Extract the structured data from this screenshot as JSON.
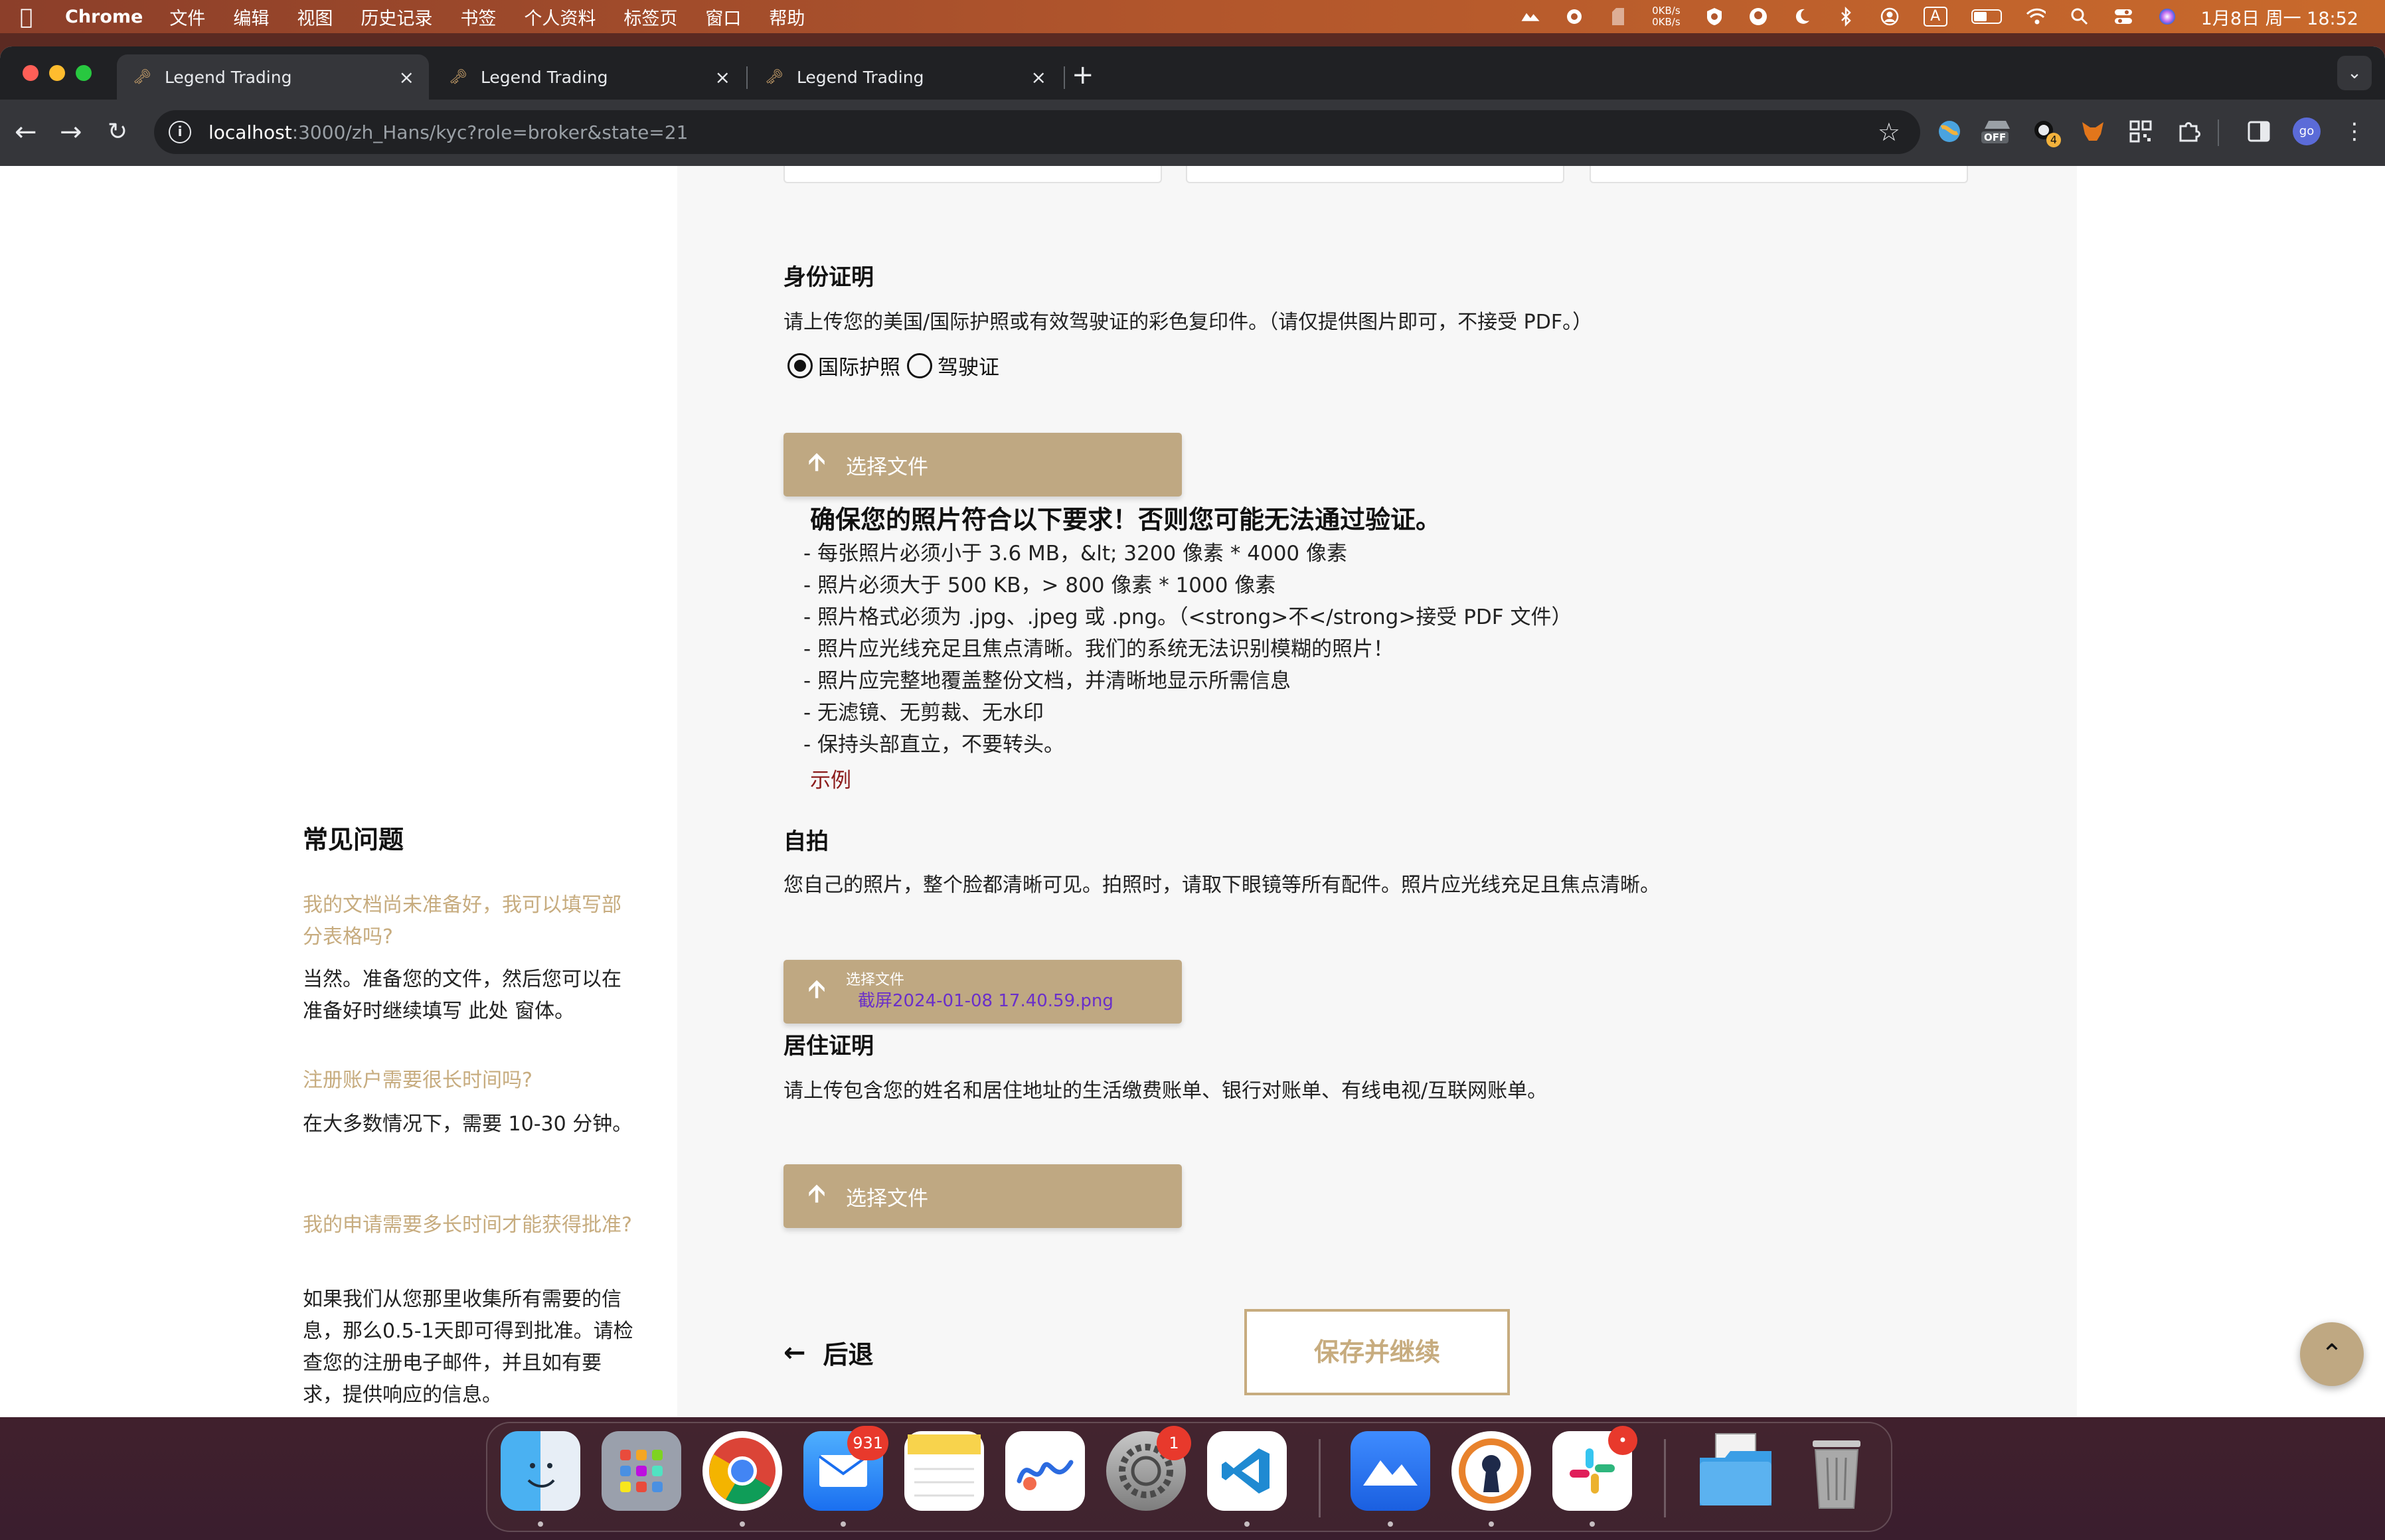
{
  "menubar": {
    "app_name": "Chrome",
    "menus": [
      "文件",
      "编辑",
      "视图",
      "历史记录",
      "书签",
      "个人资料",
      "标签页",
      "窗口",
      "帮助"
    ],
    "net_up": "0KB/s",
    "net_down": "0KB/s",
    "input_method": "A",
    "datetime": "1月8日 周一  18:52"
  },
  "tabs": [
    {
      "title": "Legend Trading",
      "active": true
    },
    {
      "title": "Legend Trading",
      "active": false
    },
    {
      "title": "Legend Trading",
      "active": false
    }
  ],
  "toolbar": {
    "url_host": "localhost",
    "url_path": ":3000/zh_Hans/kyc?role=broker&state=21",
    "ext_off_label": "OFF",
    "ext_badge": "4",
    "profile_label": "go"
  },
  "faq": {
    "title": "常见问题",
    "items": [
      {
        "q": "我的文档尚未准备好，我可以填写部分表格吗?",
        "a": "当然。准备您的文件，然后您可以在准备好时继续填写 此处 窗体。"
      },
      {
        "q": "注册账户需要很长时间吗?",
        "a": "在大多数情况下，需要 10-30 分钟。"
      },
      {
        "q": "我的申请需要多长时间才能获得批准?",
        "a": "如果我们从您那里收集所有需要的信息，那么0.5-1天即可得到批准。请检查您的注册电子邮件，并且如有要求，提供响应的信息。"
      }
    ]
  },
  "identity": {
    "title": "身份证明",
    "desc": "请上传您的美国/国际护照或有效驾驶证的彩色复印件。（请仅提供图片即可，不接受 PDF。）",
    "option_passport": "国际护照",
    "option_license": "驾驶证",
    "selected": "passport",
    "upload_label": "选择文件"
  },
  "requirements": {
    "title": "确保您的照片符合以下要求！否则您可能无法通过验证。",
    "items": [
      "- 每张照片必须小于 3.6 MB，&lt; 3200 像素 * 4000 像素",
      "- 照片必须大于 500 KB，> 800 像素 * 1000 像素",
      "- 照片格式必须为 .jpg、.jpeg 或 .png。（<strong>不</strong>接受 PDF 文件）",
      "- 照片应光线充足且焦点清晰。我们的系统无法识别模糊的照片！",
      "- 照片应完整地覆盖整份文档，并清晰地显示所需信息",
      "- 无滤镜、无剪裁、无水印",
      "- 保持头部直立，不要转头。"
    ],
    "example_link": "示例"
  },
  "selfie": {
    "title": "自拍",
    "desc": "您自己的照片，整个脸都清晰可见。拍照时，请取下眼镜等所有配件。照片应光线充足且焦点清晰。",
    "upload_label": "选择文件",
    "filename": "截屏2024-01-08 17.40.59.png"
  },
  "residence": {
    "title": "居住证明",
    "desc": "请上传包含您的姓名和居住地址的生活缴费账单、银行对账单、有线电视/互联网账单。",
    "upload_label": "选择文件"
  },
  "actions": {
    "back_label": "后退",
    "save_label": "保存并继续"
  },
  "dock": {
    "mail_badge": "931",
    "settings_badge": "1",
    "slack_badge": "•"
  },
  "colors": {
    "accent": "#bfa882",
    "faq_question": "#c7ac7f",
    "example_link": "#8b1a1a",
    "filename": "#6a2fc9"
  }
}
